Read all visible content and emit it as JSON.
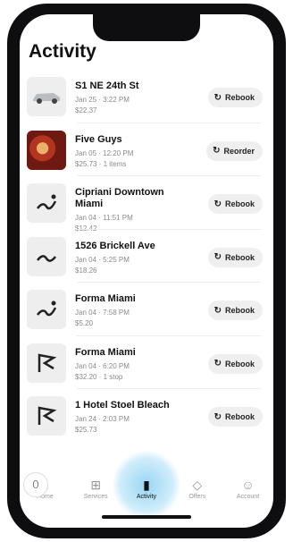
{
  "page": {
    "title": "Activity"
  },
  "activity": [
    {
      "thumb": "car",
      "name": "S1 NE 24th St",
      "meta": "Jan 25 · 3:22 PM",
      "price": "$22.37",
      "action": "Rebook"
    },
    {
      "thumb": "food",
      "name": "Five Guys",
      "meta": "Jan 05 · 12:20 PM",
      "price": "$25.73 · 1 items",
      "action": "Reorder"
    },
    {
      "thumb": "route",
      "name": "Cipriani Downtown Miami",
      "meta": "Jan 04 · 11:51 PM",
      "price": "$12.42",
      "action": "Rebook"
    },
    {
      "thumb": "route",
      "name": "1526 Brickell Ave",
      "meta": "Jan 04 · 5:25 PM",
      "price": "$18.26",
      "action": "Rebook"
    },
    {
      "thumb": "route",
      "name": "Forma Miami",
      "meta": "Jan 04 · 7:58 PM",
      "price": "$5.20",
      "action": "Rebook"
    },
    {
      "thumb": "flag",
      "name": "Forma Miami",
      "meta": "Jan 04 · 6:20 PM",
      "price": "$32.20 · 1 stop",
      "action": "Rebook"
    },
    {
      "thumb": "flag",
      "name": "1 Hotel Stoel Bleach",
      "meta": "Jan 24 · 2:03 PM",
      "price": "$25.73",
      "action": "Rebook"
    }
  ],
  "tabs": [
    {
      "label": "Home",
      "icon": "home-icon",
      "active": false
    },
    {
      "label": "Services",
      "icon": "grid-icon",
      "active": false
    },
    {
      "label": "Activity",
      "icon": "receipt-icon",
      "active": true
    },
    {
      "label": "Offers",
      "icon": "tag-icon",
      "active": false
    },
    {
      "label": "Account",
      "icon": "person-icon",
      "active": false
    }
  ]
}
